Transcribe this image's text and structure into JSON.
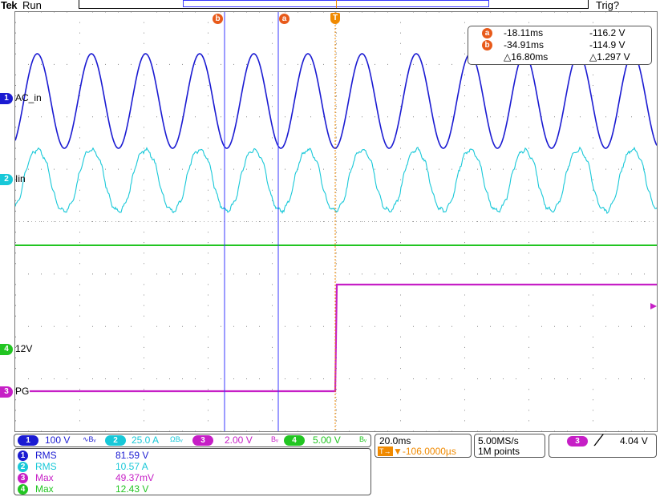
{
  "header": {
    "brand": "Tek",
    "run_state": "Run",
    "trigger_state": "Trig?"
  },
  "channels": [
    {
      "number": "1",
      "label": "AC_in",
      "color": "#1b1bd2"
    },
    {
      "number": "2",
      "label": "Iin",
      "color": "#18c8d8"
    },
    {
      "number": "4",
      "label": "12V",
      "color": "#22c522"
    },
    {
      "number": "3",
      "label": "PG",
      "color": "#c61fc6"
    }
  ],
  "cursors": {
    "a": {
      "marker": "a",
      "time": "-18.11ms",
      "value": "-116.2 V"
    },
    "b": {
      "marker": "b",
      "time": "-34.91ms",
      "value": "-114.9 V"
    },
    "delta": {
      "time": "△16.80ms",
      "value": "△1.297 V"
    }
  },
  "trigger_marker": "T",
  "scales": [
    {
      "channel": "1",
      "value": "100 V",
      "icon": "bandwidth-limit-icon",
      "icon_text": "∿Bᵥ"
    },
    {
      "channel": "2",
      "value": "25.0 A",
      "icon": "ohm-bandwidth-icon",
      "icon_text": "ΩBᵥ"
    },
    {
      "channel": "3",
      "value": "2.00 V",
      "icon": "bandwidth-icon",
      "icon_text": "Bᵥ"
    },
    {
      "channel": "4",
      "value": "5.00 V",
      "icon": "bandwidth-icon",
      "icon_text": "Bᵥ"
    }
  ],
  "timebase": {
    "scale": "20.0ms",
    "position": "▼-106.0000µs",
    "position_prefix": "T→"
  },
  "acquisition": {
    "sample_rate": "5.00MS/s",
    "record_length": "1M points"
  },
  "trigger": {
    "channel": "3",
    "slope": "rising-edge-icon",
    "level": "4.04 V"
  },
  "measurements": [
    {
      "channel": "1",
      "name": "RMS",
      "value": "81.59 V"
    },
    {
      "channel": "2",
      "name": "RMS",
      "value": "10.57 A"
    },
    {
      "channel": "3",
      "name": "Max",
      "value": "49.37mV"
    },
    {
      "channel": "4",
      "name": "Max",
      "value": "12.43 V"
    }
  ],
  "colors": {
    "ch1": "#1b1bd2",
    "ch2": "#18c8d8",
    "ch3": "#c61fc6",
    "ch4": "#22c522",
    "cursor": "#3a3aff",
    "trigger": "#f08a00",
    "cursor_badge": "#e85a1a"
  }
}
